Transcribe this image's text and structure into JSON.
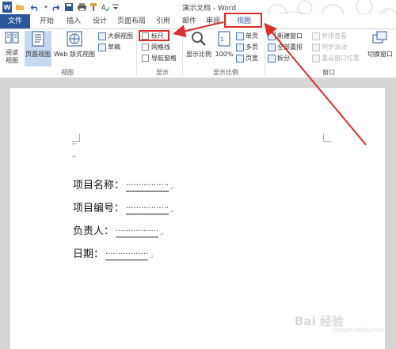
{
  "window": {
    "title": "演示文档 - Word"
  },
  "qat": {
    "undo_icon": "undo-icon",
    "redo_icon": "redo-icon"
  },
  "tabs": [
    "文件",
    "开始",
    "插入",
    "设计",
    "页面布局",
    "引用",
    "邮件",
    "审阅",
    "视图"
  ],
  "active_tab": "视图",
  "ribbon": {
    "views": {
      "label": "视图",
      "read_mode": "阅读\n视图",
      "print_layout": "页面视图",
      "web_layout": "Web 版式视图",
      "outline": "大纲视图",
      "draft": "草稿"
    },
    "show": {
      "label": "显示",
      "ruler": "标尺",
      "gridlines": "网格线",
      "nav_pane": "导航窗格",
      "ruler_checked": false,
      "gridlines_checked": false,
      "nav_pane_checked": false
    },
    "zoom": {
      "label": "显示比例",
      "zoom": "显示比例",
      "hundred": "100%",
      "one_page": "单页",
      "multi_page": "多页",
      "page_width": "页宽"
    },
    "window": {
      "label": "窗口",
      "new_window": "新建窗口",
      "arrange_all": "全部重排",
      "split": "拆分",
      "side_by_side": "并排查看",
      "sync_scroll": "同步滚动",
      "reset_pos": "重设窗口位置",
      "switch_windows": "切换窗口"
    }
  },
  "document": {
    "fields": [
      {
        "label": "项目名称：",
        "dots": "·················"
      },
      {
        "label": "项目编号：",
        "dots": "·················"
      },
      {
        "label": "负责人：",
        "dots": "·················"
      },
      {
        "label": "日期：",
        "dots": "·················"
      }
    ],
    "para_mark": "↵"
  },
  "watermark": {
    "main": "Bai 经验",
    "sub": "jingyan.baidu.com"
  },
  "colors": {
    "accent": "#2b579a",
    "highlight": "#e02b2b"
  }
}
